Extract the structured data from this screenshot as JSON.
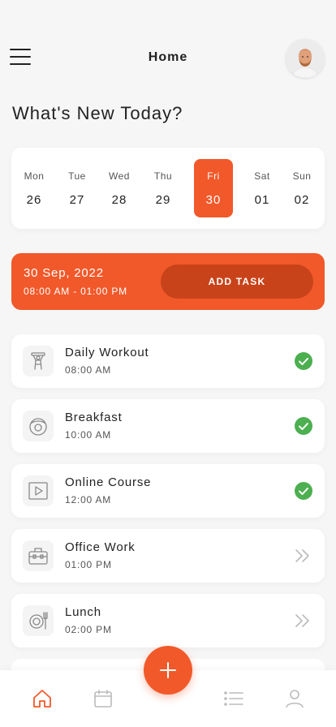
{
  "header": {
    "title": "Home"
  },
  "headline": "What's New Today?",
  "week": [
    {
      "name": "Mon",
      "num": "26"
    },
    {
      "name": "Tue",
      "num": "27"
    },
    {
      "name": "Wed",
      "num": "28"
    },
    {
      "name": "Thu",
      "num": "29"
    },
    {
      "name": "Fri",
      "num": "30"
    },
    {
      "name": "Sat",
      "num": "01"
    },
    {
      "name": "Sun",
      "num": "02"
    }
  ],
  "selected_day": "Fri",
  "banner": {
    "date": "30 Sep, 2022",
    "time_range": "08:00 AM - 01:00 PM",
    "button_label": "ADD TASK"
  },
  "tasks": [
    {
      "name": "Daily Workout",
      "time": "08:00 AM",
      "status": "done",
      "icon": "workout-icon"
    },
    {
      "name": "Breakfast",
      "time": "10:00 AM",
      "status": "done",
      "icon": "breakfast-icon"
    },
    {
      "name": "Online Course",
      "time": "12:00 AM",
      "status": "done",
      "icon": "video-play-icon"
    },
    {
      "name": "Office Work",
      "time": "01:00 PM",
      "status": "pending",
      "icon": "briefcase-icon"
    },
    {
      "name": "Lunch",
      "time": "02:00 PM",
      "status": "pending",
      "icon": "plate-cutlery-icon"
    }
  ],
  "colors": {
    "accent": "#f1592a",
    "accent_dark": "#c8431a",
    "done": "#4caf50",
    "background": "#f6f6f6"
  },
  "nav": [
    {
      "icon": "home-icon",
      "active": true
    },
    {
      "icon": "calendar-icon",
      "active": false
    },
    {
      "icon": "add-icon",
      "active": false
    },
    {
      "icon": "list-icon",
      "active": false
    },
    {
      "icon": "profile-icon",
      "active": false
    }
  ]
}
